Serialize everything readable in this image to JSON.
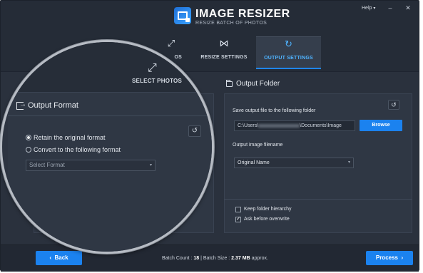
{
  "app": {
    "title": "IMAGE RESIZER",
    "subtitle": "RESIZE BATCH OF PHOTOS"
  },
  "window_controls": {
    "help_label": "Help",
    "minimize": "–",
    "close": "✕"
  },
  "tabs": [
    {
      "label": "SELECT PHOTOS",
      "partial_label": "OS",
      "icon": "expand-arrows-icon"
    },
    {
      "label": "RESIZE SETTINGS",
      "icon": "resize-bowtie-icon"
    },
    {
      "label": "OUTPUT SETTINGS",
      "icon": "rotate-arrow-icon",
      "active": true
    }
  ],
  "output_format": {
    "title": "Output Format",
    "options": [
      {
        "label": "Retain the original format",
        "selected": true
      },
      {
        "label": "Convert to the following format",
        "selected": false
      }
    ],
    "select_placeholder": "Select Format"
  },
  "output_folder": {
    "title": "Output Folder",
    "save_label": "Save output file to the following folder",
    "path_prefix": "C:\\Users\\",
    "path_suffix": "\\Documents\\Image",
    "browse_label": "Browse",
    "filename_label": "Output image filename",
    "filename_value": "Original Name",
    "keep_hierarchy_label": "Keep folder hierarchy",
    "keep_hierarchy_checked": false,
    "ask_overwrite_label": "Ask before overwrite",
    "ask_overwrite_checked": true
  },
  "footer": {
    "back_label": "Back",
    "process_label": "Process",
    "batch_count_label": "Batch Count : ",
    "batch_count_value": "18",
    "batch_size_label": " | Batch Size : ",
    "batch_size_value": "2.37 MB",
    "batch_size_suffix": " approx."
  },
  "colors": {
    "accent": "#1b82ef",
    "active_tab_text": "#4fb3ff",
    "background": "#2a313d"
  }
}
